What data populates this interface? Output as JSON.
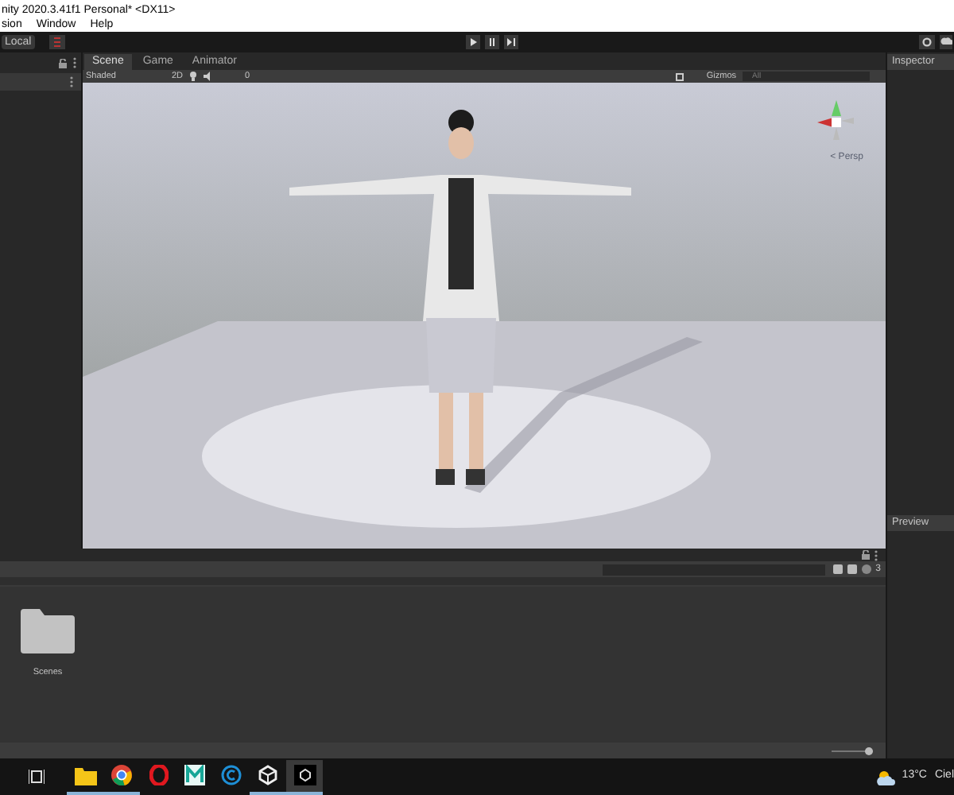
{
  "window": {
    "title": "nity 2020.3.41f1 Personal* <DX11>"
  },
  "menu": [
    "sion",
    "Window",
    "Help"
  ],
  "toolbar": {
    "pivot": "Local"
  },
  "scene_tabs": [
    {
      "label": "Scene",
      "selected": true
    },
    {
      "label": "Game",
      "selected": false
    },
    {
      "label": "Animator",
      "selected": false
    }
  ],
  "scene_toolbar": {
    "shading": "Shaded",
    "mode_2d": "2D",
    "hidden_count": "0",
    "gizmos": "Gizmos",
    "search": {
      "placeholder": "All"
    }
  },
  "viewport": {
    "kind": "picture",
    "projection": "< Persp"
  },
  "inspector": {
    "tab": "Inspector",
    "preview": "Preview"
  },
  "project": {
    "hidden_count": "3",
    "items": [
      {
        "name": "Scenes"
      }
    ],
    "zoom": {
      "level": 0.9
    }
  },
  "taskbar": {
    "apps": [
      {
        "kind": "explorer",
        "running": true,
        "selected": false
      },
      {
        "kind": "chrome",
        "running": true,
        "selected": false
      },
      {
        "kind": "opera",
        "running": false,
        "selected": false
      },
      {
        "kind": "m",
        "running": false,
        "selected": false
      },
      {
        "kind": "c",
        "running": false,
        "selected": false
      },
      {
        "kind": "unity",
        "running": true,
        "selected": false
      },
      {
        "kind": "editor",
        "running": true,
        "selected": true
      }
    ],
    "weather": "13°C",
    "weather_text": "Ciel"
  }
}
